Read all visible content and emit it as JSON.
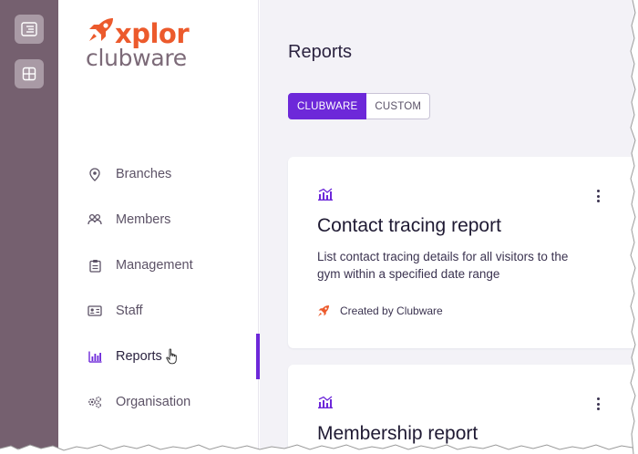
{
  "rail": {
    "buttons": [
      {
        "icon": "menu-collapse-icon"
      },
      {
        "icon": "grid-icon"
      }
    ]
  },
  "brand": {
    "line1": "xplor",
    "line2": "clubware",
    "icon": "rocket-icon",
    "accent": "#ec5a2c",
    "secondary": "#7c6a78"
  },
  "sidebar": {
    "items": [
      {
        "label": "Branches",
        "icon": "location-pin-icon"
      },
      {
        "label": "Members",
        "icon": "members-icon"
      },
      {
        "label": "Management",
        "icon": "clipboard-icon"
      },
      {
        "label": "Staff",
        "icon": "id-card-icon"
      },
      {
        "label": "Reports",
        "icon": "bar-chart-icon",
        "active": true
      },
      {
        "label": "Organisation",
        "icon": "gears-icon"
      }
    ],
    "active_color": "#6d28d9"
  },
  "main": {
    "title": "Reports",
    "tabs": [
      {
        "label": "CLUBWARE",
        "selected": true
      },
      {
        "label": "CUSTOM",
        "selected": false
      }
    ],
    "cards": [
      {
        "title": "Contact tracing report",
        "description": "List contact tracing details for all visitors to the gym within a specified date range",
        "created_by": "Created by Clubware",
        "icon": "report-chart-icon",
        "menu_icon": "kebab-menu-icon"
      },
      {
        "title": "Membership report",
        "icon": "report-chart-icon",
        "menu_icon": "kebab-menu-icon"
      }
    ]
  },
  "colors": {
    "rail": "#75606f",
    "primary": "#6d28d9",
    "background": "#f3f2f7"
  }
}
